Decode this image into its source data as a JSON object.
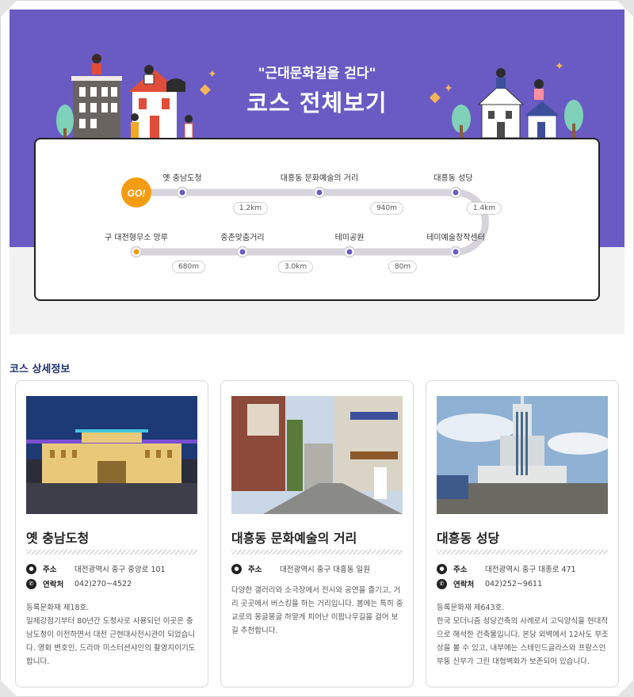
{
  "hero": {
    "subtitle": "\"근대문화길을 걷다\"",
    "title": "코스 전체보기"
  },
  "course": {
    "start_badge": "GO!",
    "row1": [
      {
        "label": "옛 충남도청"
      },
      {
        "label": "대흥동 문화예술의 거리"
      },
      {
        "label": "대흥동 성당"
      }
    ],
    "row2": [
      {
        "label": "구 대전형무소 망루"
      },
      {
        "label": "중촌맞춤거리"
      },
      {
        "label": "테미공원"
      },
      {
        "label": "테미예술창작센터"
      }
    ],
    "distances": [
      "1.2km",
      "940m",
      "1.4km",
      "680m",
      "3.0km",
      "80m"
    ],
    "colors": {
      "track": "#d6d3db",
      "node": "#6a5bc4",
      "start": "#f39c12"
    }
  },
  "detail": {
    "section_title": "코스 상세정보",
    "address_label": "주소",
    "contact_label": "연락처",
    "cards": [
      {
        "title": "옛 충남도청",
        "address": "대전광역시 중구 중앙로 101",
        "phone": "042)270~4522",
        "desc": "등록문화재 제18호.\n일제강점기부터 80년간 도청사로 사용되던 이곳은 충남도청이 이전하면서 대전 근현대사전시관이 되었습니다. 영화 변호인, 드라마 미스터션샤인의 촬영지이기도 합니다."
      },
      {
        "title": "대흥동 문화예술의 거리",
        "address": "대전광역시 중구 대흥동 일원",
        "desc": "다양한 갤러리와 소극장에서 전시와 공연을 즐기고, 거리 곳곳에서 버스킹을 하는 거리입니다. 봄에는 특히 중교로의 몽글몽글 하얗게 피어난 이팝나무길을 걸어 보길 추천합니다."
      },
      {
        "title": "대흥동 성당",
        "address": "대전광역시 중구 대종로 471",
        "phone": "042)252~9611",
        "desc": "등록문화재 제643호.\n한국 모더니즘 성당건축의 사례로서 고딕양식을 현대적으로 해석한 건축물입니다. 본당 외벽에서 12사도 부조상을 볼 수 있고, 내부에는 스테인드글라스와 프랑스인 부뚱 신부가 그린 대형벽화가 보존되어 있습니다."
      }
    ]
  }
}
